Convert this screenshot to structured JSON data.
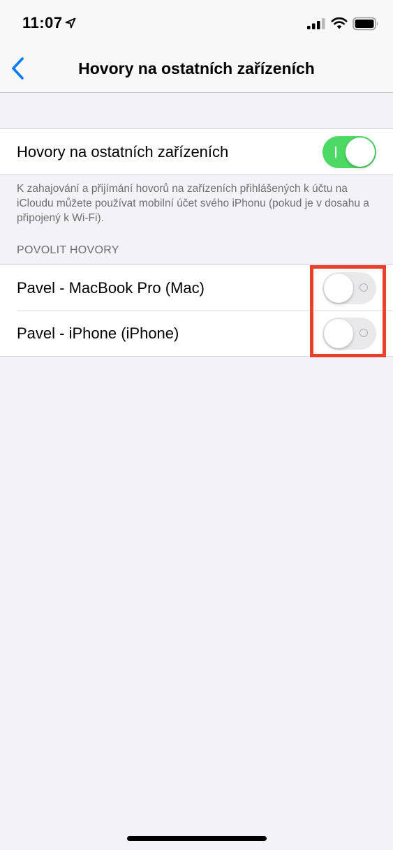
{
  "status_bar": {
    "time": "11:07",
    "icons": [
      "location-arrow-icon",
      "cellular-signal-icon",
      "wifi-icon",
      "battery-icon"
    ]
  },
  "nav": {
    "back_icon": "chevron-left-icon",
    "title": "Hovory na ostatních zařízeních"
  },
  "main_setting": {
    "label": "Hovory na ostatních zařízeních",
    "enabled": true
  },
  "footer_note": "K zahajování a přijímání hovorů na zařízeních přihlášených k účtu na iCloudu můžete používat mobilní účet svého iPhonu (pokud je v dosahu a připojený k Wi-Fi).",
  "allow_calls": {
    "header": "POVOLIT HOVORY",
    "devices": [
      {
        "label": "Pavel - MacBook Pro (Mac)",
        "enabled": false
      },
      {
        "label": "Pavel - iPhone (iPhone)",
        "enabled": false
      }
    ]
  },
  "colors": {
    "accent": "#007aff",
    "toggle_on": "#4cd964",
    "toggle_off": "#e9e9eb",
    "highlight": "#e8402d",
    "background": "#f2f2f7"
  }
}
